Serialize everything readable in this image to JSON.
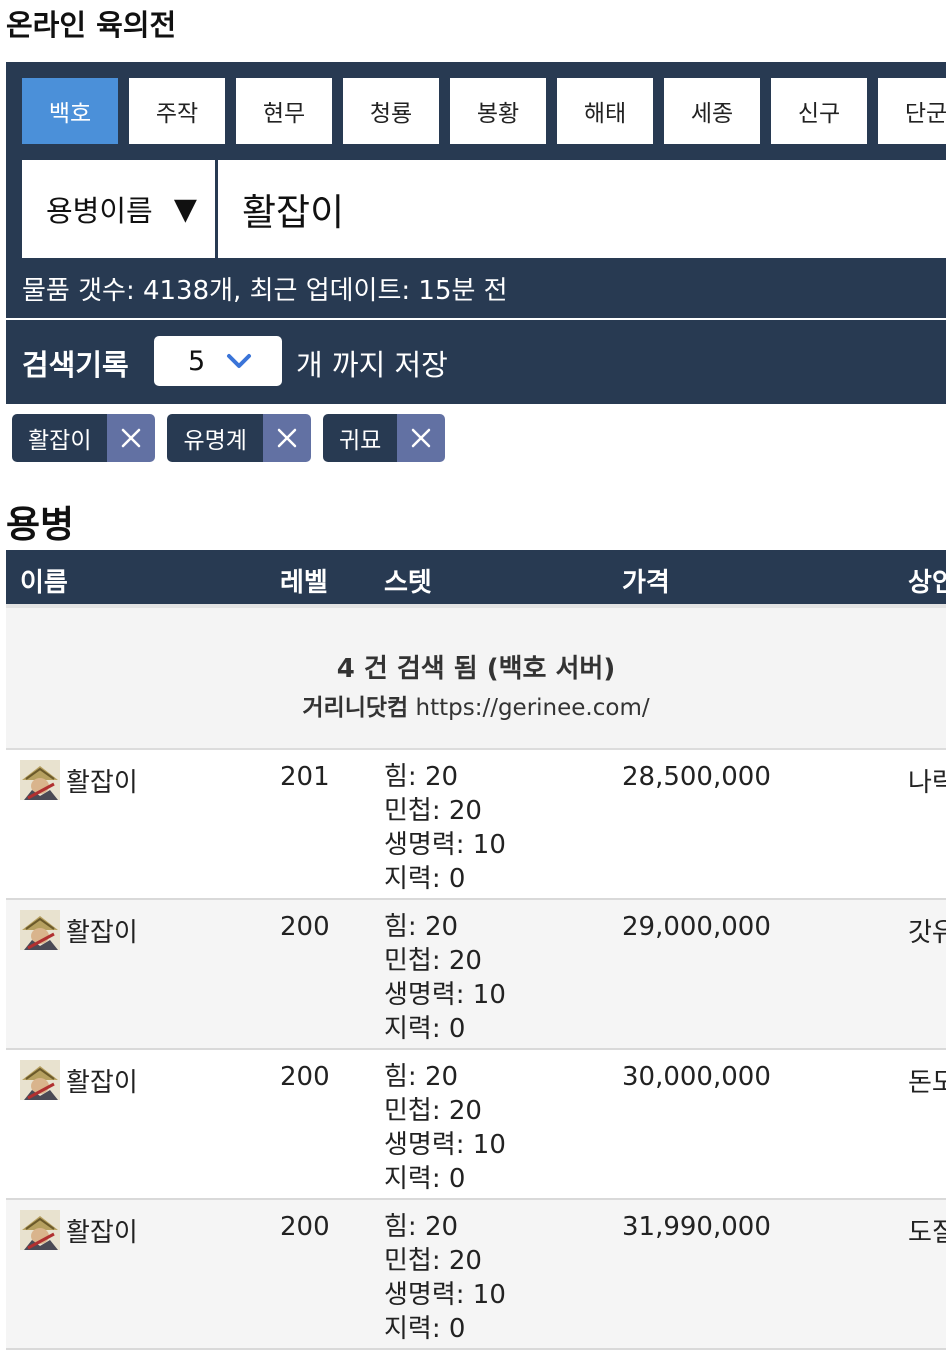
{
  "app_title": "온라인 육의전",
  "servers": [
    "백호",
    "주작",
    "현무",
    "청룡",
    "봉황",
    "해태",
    "세종",
    "신구",
    "단군"
  ],
  "active_server": "백호",
  "search": {
    "type_label": "용병이름",
    "type_arrow": "▼",
    "value": "활잡이"
  },
  "item_count_text": "물품 갯수: 4138개, 최근 업데이트: 15분 전",
  "history": {
    "title": "검색기록",
    "limit_value": "5",
    "suffix": "개 까지 저장",
    "chips": [
      "활잡이",
      "유명계",
      "귀묘"
    ]
  },
  "section_title": "용병",
  "table": {
    "headers": {
      "name": "이름",
      "level": "레벨",
      "stats": "스텟",
      "price": "가격",
      "shop": "상인"
    },
    "summary": {
      "count_text": "4 건 검색 됨 (백호 서버)",
      "site_name": "거리니닷컴",
      "site_url": "https://gerinee.com/"
    },
    "rows": [
      {
        "name": "활잡이",
        "level": "201",
        "stat_str": "힘: 20",
        "stat_dex": "민첩: 20",
        "stat_hp": "생명력: 10",
        "stat_int": "지력: 0",
        "price": "28,500,000",
        "shop": "나락"
      },
      {
        "name": "활잡이",
        "level": "200",
        "stat_str": "힘: 20",
        "stat_dex": "민첩: 20",
        "stat_hp": "생명력: 10",
        "stat_int": "지력: 0",
        "price": "29,000,000",
        "shop": "갓유"
      },
      {
        "name": "활잡이",
        "level": "200",
        "stat_str": "힘: 20",
        "stat_dex": "민첩: 20",
        "stat_hp": "생명력: 10",
        "stat_int": "지력: 0",
        "price": "30,000,000",
        "shop": "돈도"
      },
      {
        "name": "활잡이",
        "level": "200",
        "stat_str": "힘: 20",
        "stat_dex": "민첩: 20",
        "stat_hp": "생명력: 10",
        "stat_int": "지력: 0",
        "price": "31,990,000",
        "shop": "도질"
      }
    ]
  },
  "colors": {
    "panel": "#283a52",
    "active_tab": "#4b90d9",
    "chip_remove": "#6271a3"
  }
}
